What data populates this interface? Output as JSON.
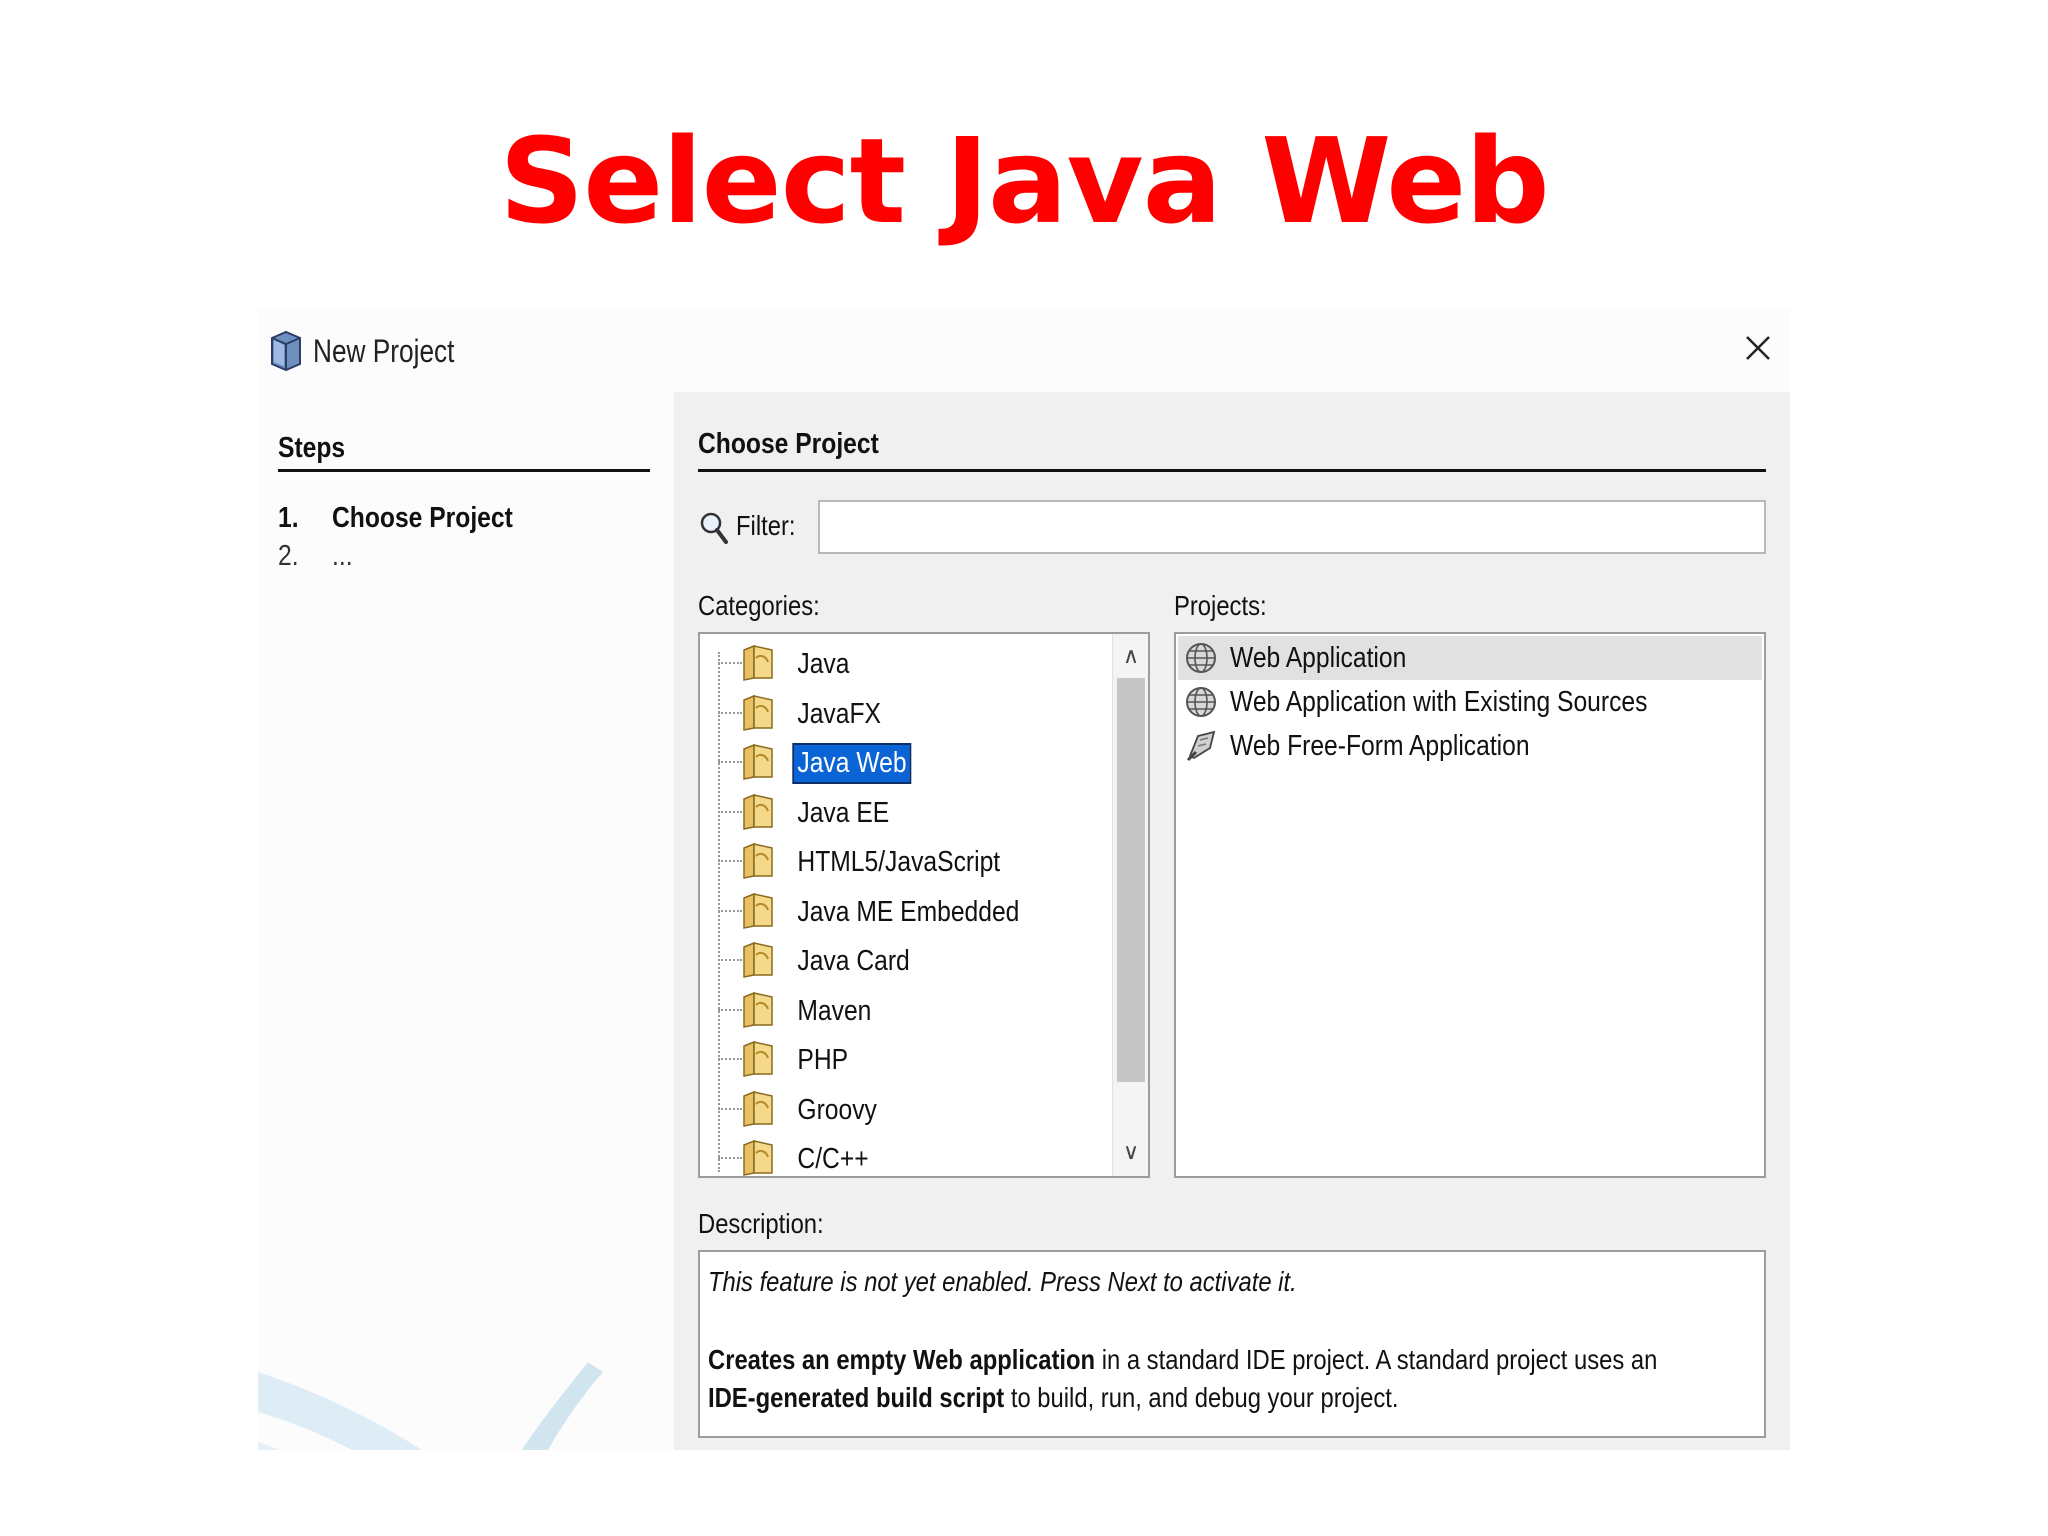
{
  "slide": {
    "title": "Select Java Web"
  },
  "dialog": {
    "title": "New Project",
    "steps": {
      "heading": "Steps",
      "items": [
        {
          "num": "1.",
          "label": "Choose Project"
        },
        {
          "num": "2.",
          "label": "..."
        }
      ]
    },
    "panel": {
      "heading": "Choose Project",
      "filter": {
        "label": "Filter:",
        "value": ""
      },
      "categories": {
        "label": "Categories:",
        "selected": "Java Web",
        "items": [
          "Java",
          "JavaFX",
          "Java Web",
          "Java EE",
          "HTML5/JavaScript",
          "Java ME Embedded",
          "Java Card",
          "Maven",
          "PHP",
          "Groovy",
          "C/C++"
        ]
      },
      "projects": {
        "label": "Projects:",
        "selected": "Web Application",
        "items": [
          {
            "label": "Web Application",
            "icon": "globe-icon"
          },
          {
            "label": "Web Application with Existing Sources",
            "icon": "globe-icon"
          },
          {
            "label": "Web Free-Form Application",
            "icon": "free-form-icon"
          }
        ]
      },
      "description": {
        "label": "Description:",
        "note": "This feature is not yet enabled. Press Next to activate it.",
        "line1_bold": "Creates an empty Web application",
        "line1_rest": " in a standard IDE project. A standard project uses an",
        "line2_bold": "IDE-generated build script",
        "line2_rest": " to build, run, and debug your project."
      }
    }
  },
  "colors": {
    "title_red": "#ff0000",
    "selection_blue": "#0a64d6"
  }
}
